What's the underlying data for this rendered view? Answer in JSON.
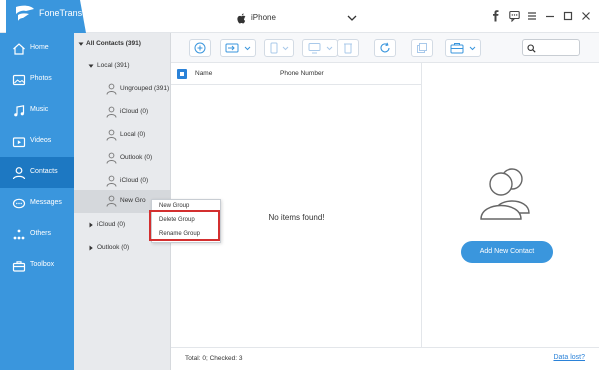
{
  "app": {
    "name": "FoneTrans",
    "device": "iPhone",
    "brand_color": "#3a96dd",
    "active_color": "#1d78c2",
    "accent_red": "#d32f2f"
  },
  "window_icons": [
    "facebook-icon",
    "feedback-icon",
    "menu-icon",
    "minimize-icon",
    "maximize-icon",
    "close-icon"
  ],
  "sidebar": {
    "items": [
      {
        "label": "Home",
        "icon": "home-icon"
      },
      {
        "label": "Photos",
        "icon": "photos-icon"
      },
      {
        "label": "Music",
        "icon": "music-icon"
      },
      {
        "label": "Videos",
        "icon": "videos-icon"
      },
      {
        "label": "Contacts",
        "icon": "contacts-icon",
        "active": true
      },
      {
        "label": "Messages",
        "icon": "messages-icon"
      },
      {
        "label": "Others",
        "icon": "others-icon"
      },
      {
        "label": "Toolbox",
        "icon": "toolbox-icon"
      }
    ]
  },
  "tree": {
    "all_contacts": "All Contacts  (391)",
    "local": "Local  (391)",
    "local_children": [
      "Ungrouped  (391)",
      "iCloud  (0)",
      "Local  (0)",
      "Outlook  (0)",
      "iCloud  (0)",
      "New Gro"
    ],
    "icloud": "iCloud  (0)",
    "outlook": "Outlook  (0)"
  },
  "toolbar": {
    "buttons": [
      "add-icon",
      "import-icon",
      "export-icon",
      "device-transfer-icon",
      "delete-icon",
      "refresh-icon",
      "duplicate-icon",
      "toolbox-icon"
    ],
    "search_placeholder": ""
  },
  "list": {
    "columns": [
      "Name",
      "Phone Number"
    ],
    "empty_text": "No items found!"
  },
  "detail": {
    "add_button": "Add New Contact"
  },
  "status": {
    "text": "Total: 0; Checked: 3",
    "link": "Data lost?"
  },
  "context_menu": {
    "items": [
      "New Group",
      "Delete Group",
      "Rename Group"
    ]
  }
}
